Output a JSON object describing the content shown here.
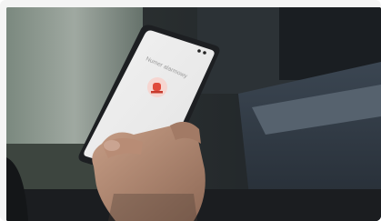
{
  "photo": {
    "description_free": true,
    "phone_screen": {
      "heading": "Numer alarmowy",
      "alarm_icon": "alarm-light-icon",
      "alarm_color": "#e04a3c"
    }
  }
}
